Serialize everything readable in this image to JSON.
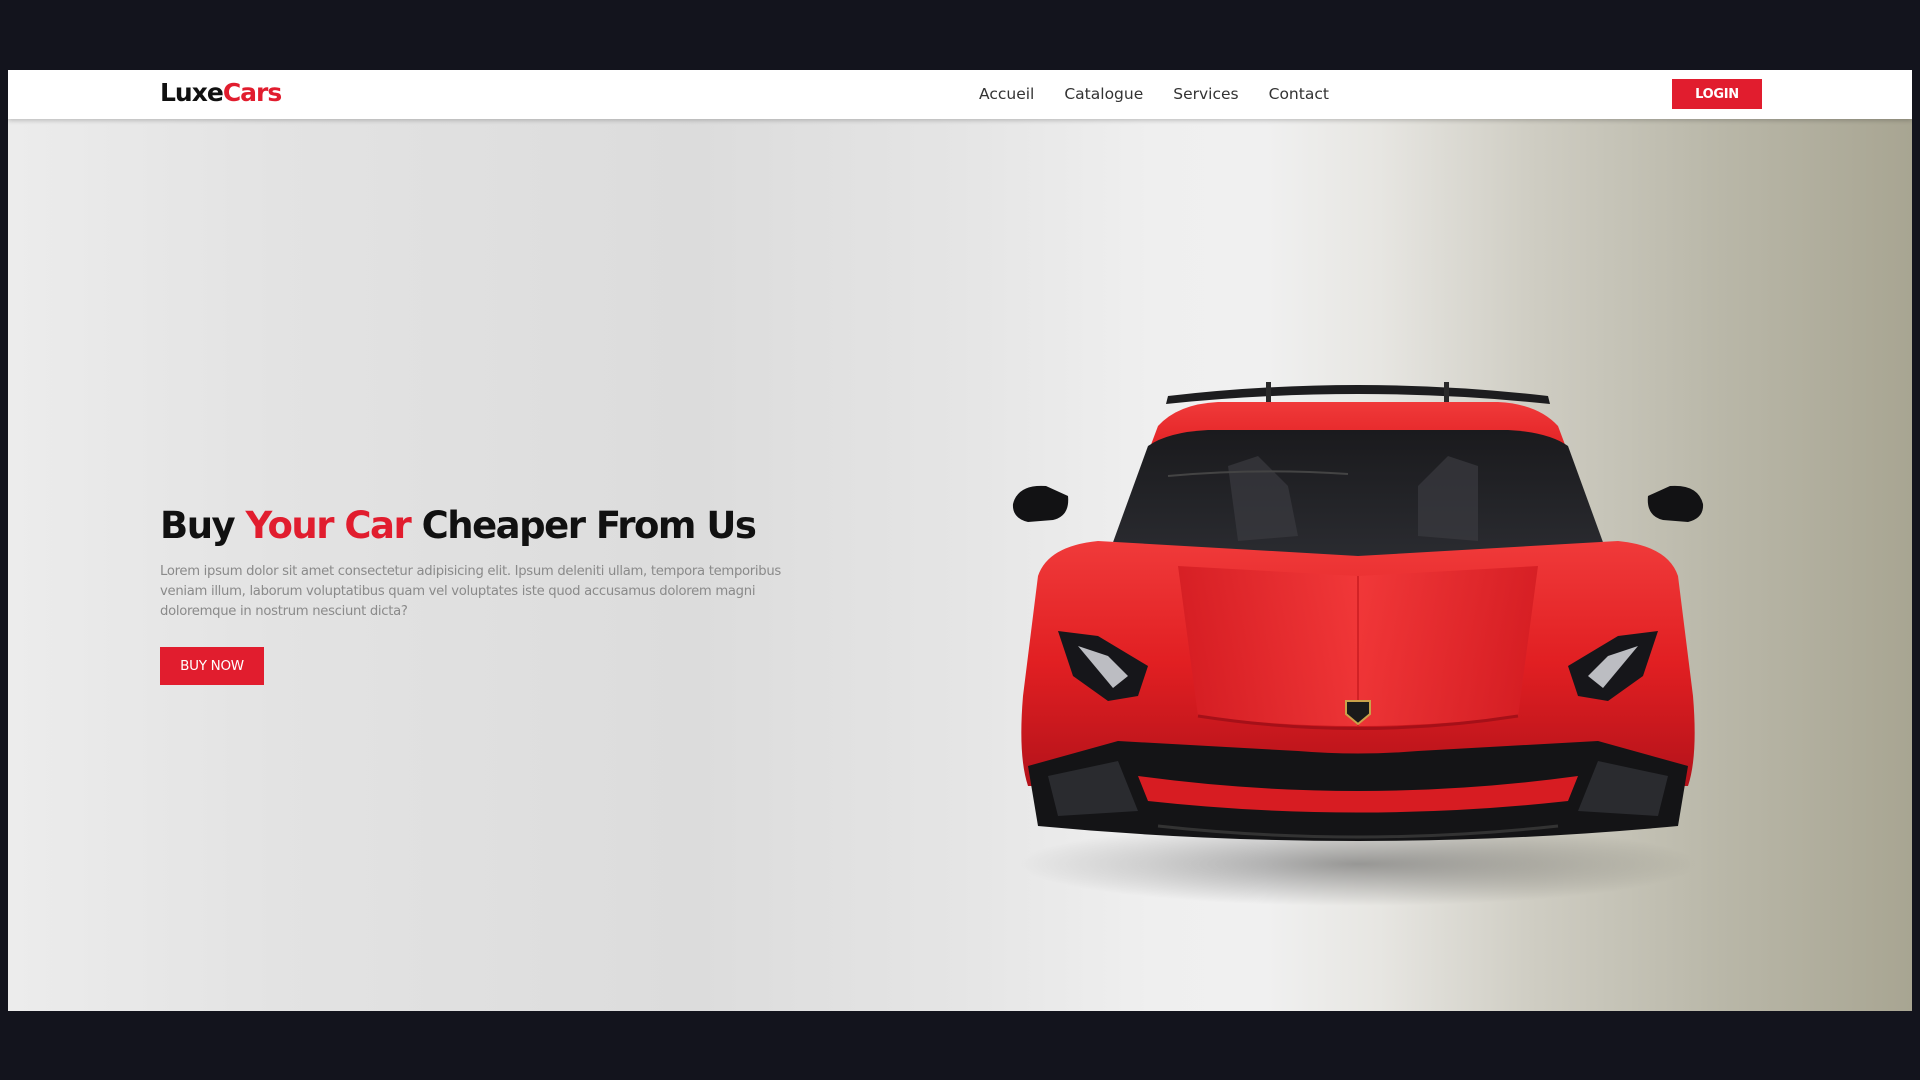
{
  "logo": {
    "part1": "Luxe",
    "part2": "Cars"
  },
  "nav": {
    "links": [
      "Accueil",
      "Catalogue",
      "Services",
      "Contact"
    ],
    "login_label": "LOGIN"
  },
  "hero": {
    "title_part1": "Buy ",
    "title_accent": "Your Car",
    "title_part2": " Cheaper From Us",
    "description": "Lorem ipsum dolor sit amet consectetur adipisicing elit. Ipsum deleniti ullam, tempora temporibus veniam illum, laborum voluptatibus quam vel voluptates iste quod accusamus dolorem magni doloremque in nostrum nesciunt dicta?",
    "cta_label": "BUY NOW",
    "image": "red-sports-car-front-view"
  },
  "colors": {
    "accent": "#e11d2e",
    "page_background": "#13141d",
    "text_dark": "#111111",
    "text_muted": "#8a8a8a"
  }
}
